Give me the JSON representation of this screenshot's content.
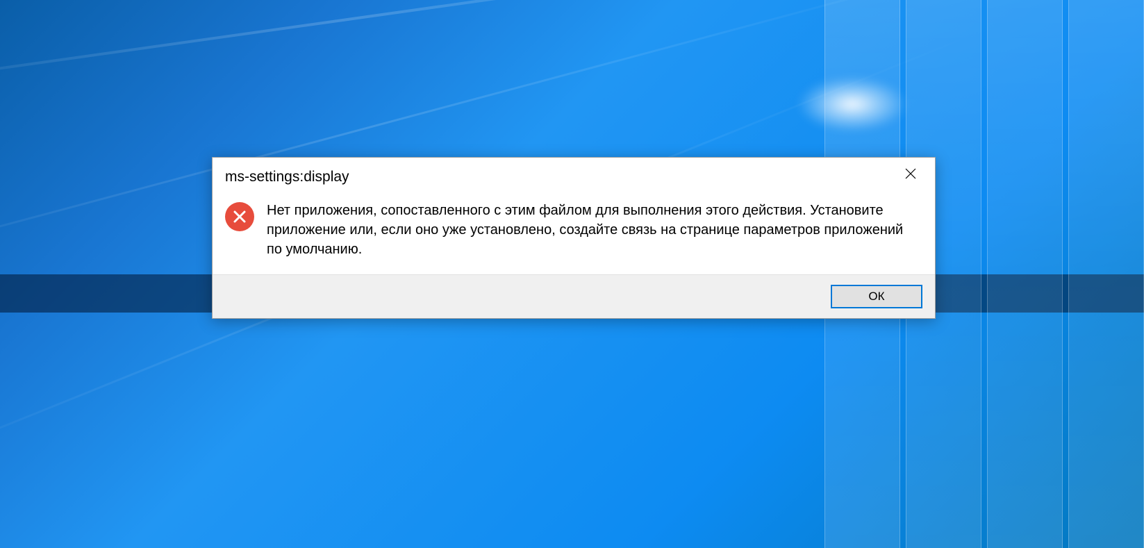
{
  "dialog": {
    "title": "ms-settings:display",
    "message": "Нет приложения, сопоставленного с этим файлом для выполнения этого действия. Установите приложение или, если оно уже установлено, создайте связь на странице параметров приложений по умолчанию.",
    "ok_label": "ОК"
  }
}
